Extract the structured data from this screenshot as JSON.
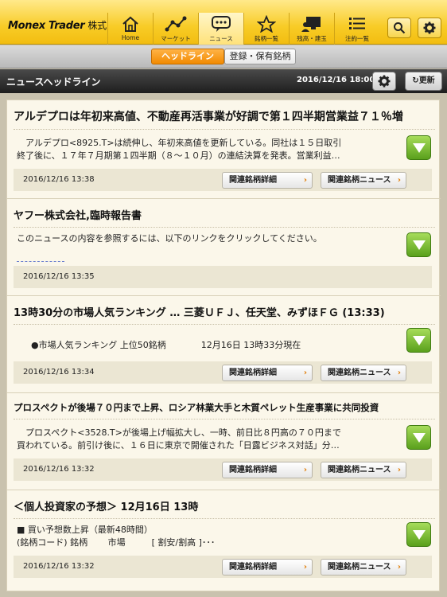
{
  "app": {
    "brand": "Monex Trader",
    "brand_jp": "株式"
  },
  "nav": [
    {
      "label": "Home",
      "icon": "home-icon"
    },
    {
      "label": "マーケット",
      "icon": "market-chart-icon"
    },
    {
      "label": "ニュース",
      "icon": "news-bubble-icon"
    },
    {
      "label": "銘柄一覧",
      "icon": "star-icon"
    },
    {
      "label": "残高・建玉",
      "icon": "portfolio-monitor-icon"
    },
    {
      "label": "注約一覧",
      "icon": "list-icon"
    }
  ],
  "tabs": {
    "headlines": "ヘッドライン",
    "holdings": "登録・保有銘柄"
  },
  "header": {
    "title": "ニュースヘッドライン",
    "timestamp": "2016/12/16 18:00",
    "refresh": "更新"
  },
  "colors": {
    "brand_yellow": "#f8cc27",
    "accent_orange": "#f28a00",
    "arrow_green": "#5aa01c"
  },
  "buttons": {
    "related_detail": "関連銘柄詳細",
    "related_news": "関連銘柄ニュース"
  },
  "news": [
    {
      "headline": "アルデプロは年初来高値、不動産再活事業が好調で第１四半期営業益７１％増",
      "lines": [
        "　アルデプロ<8925.T>は続伸し、年初来高値を更新している。同社は１５日取引",
        "終了後に、１７年７月期第１四半期（８～１０月）の連結決算を発表。営業利益…"
      ],
      "time": "2016/12/16 13:38"
    },
    {
      "headline": "ヤフー株式会社,臨時報告書",
      "lines": [
        "このニュースの内容を参照するには、以下のリンクをクリックしてください。"
      ],
      "time": "2016/12/16 13:35"
    },
    {
      "headline": "13時30分の市場人気ランキング … 三菱ＵＦＪ、任天堂、みずほＦＧ (13:33)",
      "lines": [
        "●市場人気ランキング 上位50銘柄　　　　12月16日 13時33分現在"
      ],
      "time": "2016/12/16 13:34"
    },
    {
      "headline": "プロスペクトが後場７０円まで上昇、ロシア林業大手と木質ペレット生産事業に共同投資",
      "lines": [
        "　プロスペクト<3528.T>が後場上げ幅拡大し、一時、前日比８円高の７０円まで",
        "買われている。前引け後に、１６日に東京で開催された「日露ビジネス対話」分…"
      ],
      "time": "2016/12/16 13:32"
    },
    {
      "headline": "＜個人投資家の予想＞ 12月16日 13時",
      "lines": [
        "■ 買い予想数上昇（最新48時間）",
        "(銘柄コード) 銘柄　　 市場　　　[ 割安/割高 ]･･･"
      ],
      "time": "2016/12/16 13:32"
    }
  ]
}
